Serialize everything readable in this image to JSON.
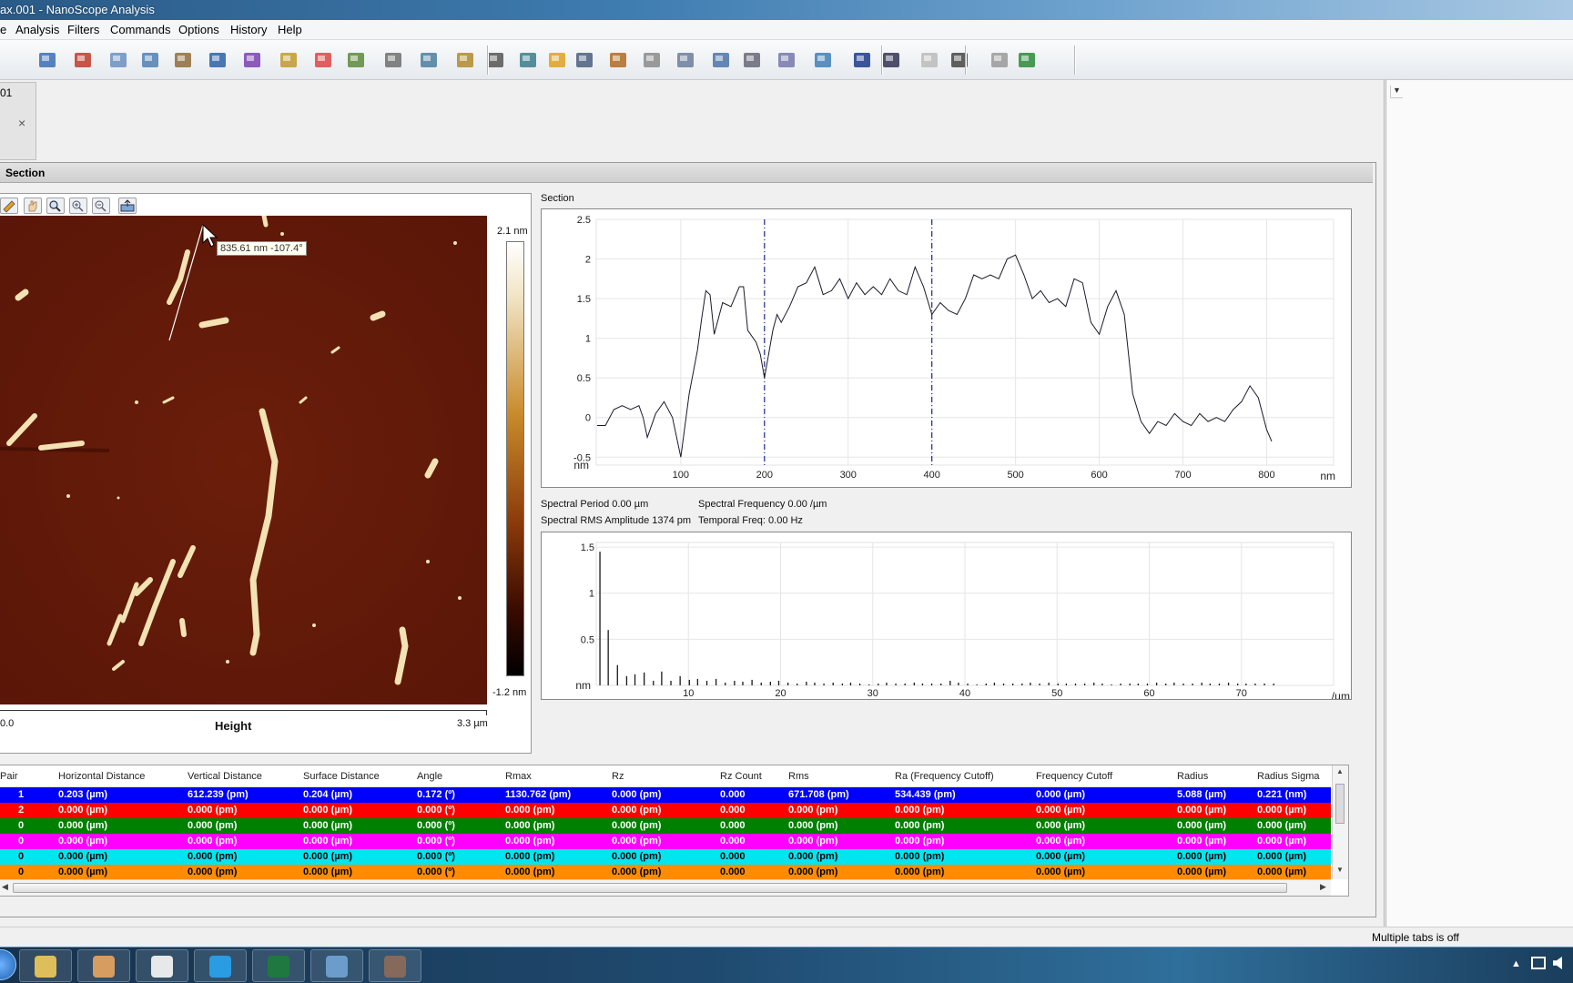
{
  "window": {
    "title": "ax.001 - NanoScope Analysis"
  },
  "menu": [
    "Analysis",
    "Filters",
    "Commands",
    "Options",
    "History",
    "Help"
  ],
  "doc_tab": {
    "label": "01",
    "close": "×"
  },
  "section": {
    "header": "Section"
  },
  "image": {
    "scale_max": "2.1 nm",
    "scale_min": "-1.2 nm",
    "x_start": "0.0",
    "x_end": "3.3 µm",
    "channel": "Height",
    "tooltip": "835.61 nm -107.4°"
  },
  "profile_chart": {
    "title": "Section",
    "y_unit": "nm",
    "x_unit": "nm",
    "y_ticks": [
      "2.5",
      "2",
      "1.5",
      "1",
      "0.5",
      "0",
      "-0.5"
    ],
    "x_ticks": [
      "100",
      "200",
      "300",
      "400",
      "500",
      "600",
      "700",
      "800"
    ]
  },
  "spectral": {
    "period": "Spectral Period 0.00 µm",
    "frequency": "Spectral Frequency 0.00 /µm",
    "rms": "Spectral RMS Amplitude 1374 pm",
    "temporal": "Temporal Freq: 0.00 Hz"
  },
  "spectrum_chart": {
    "y_unit": "nm",
    "x_unit": "/µm",
    "y_ticks": [
      "1.5",
      "1",
      "0.5"
    ],
    "x_ticks": [
      "10",
      "20",
      "30",
      "40",
      "50",
      "60",
      "70"
    ]
  },
  "chart_data": [
    {
      "type": "line",
      "title": "Section",
      "xlabel": "nm",
      "ylabel": "nm",
      "xlim": [
        -1,
        880
      ],
      "ylim": [
        -0.6,
        2.5
      ],
      "cursors_x": [
        200,
        400
      ],
      "x": [
        0,
        10,
        20,
        30,
        40,
        50,
        55,
        60,
        70,
        80,
        90,
        100,
        110,
        120,
        125,
        130,
        135,
        140,
        150,
        160,
        170,
        175,
        180,
        190,
        195,
        200,
        210,
        215,
        220,
        230,
        240,
        250,
        260,
        270,
        280,
        290,
        300,
        310,
        320,
        330,
        340,
        350,
        360,
        370,
        380,
        390,
        400,
        410,
        420,
        430,
        440,
        450,
        460,
        470,
        480,
        490,
        500,
        510,
        520,
        530,
        540,
        550,
        560,
        570,
        580,
        590,
        600,
        610,
        620,
        630,
        640,
        650,
        660,
        670,
        680,
        690,
        700,
        710,
        720,
        730,
        740,
        750,
        760,
        770,
        780,
        790,
        800,
        806
      ],
      "y": [
        -0.1,
        -0.1,
        0.1,
        0.15,
        0.1,
        0.15,
        0.0,
        -0.25,
        0.05,
        0.2,
        0.0,
        -0.5,
        0.3,
        0.85,
        1.25,
        1.6,
        1.55,
        1.05,
        1.45,
        1.4,
        1.65,
        1.65,
        1.1,
        0.95,
        0.8,
        0.5,
        1.1,
        1.3,
        1.2,
        1.4,
        1.65,
        1.7,
        1.9,
        1.55,
        1.6,
        1.75,
        1.5,
        1.7,
        1.55,
        1.65,
        1.55,
        1.75,
        1.6,
        1.55,
        1.9,
        1.65,
        1.3,
        1.45,
        1.35,
        1.3,
        1.5,
        1.8,
        1.75,
        1.8,
        1.75,
        2.0,
        2.05,
        1.8,
        1.5,
        1.6,
        1.45,
        1.5,
        1.4,
        1.75,
        1.7,
        1.2,
        1.05,
        1.4,
        1.6,
        1.3,
        0.3,
        -0.05,
        -0.2,
        -0.05,
        -0.1,
        0.05,
        -0.05,
        -0.1,
        0.05,
        -0.05,
        0.0,
        -0.05,
        0.1,
        0.2,
        0.4,
        0.25,
        -0.15,
        -0.3
      ]
    },
    {
      "type": "bar",
      "xlabel": "/µm",
      "ylabel": "nm",
      "xlim": [
        0,
        80
      ],
      "ylim": [
        0,
        1.55
      ],
      "x": [
        0.4,
        1.3,
        2.3,
        3.3,
        4.2,
        5.2,
        6.2,
        7.1,
        8.1,
        9.1,
        10.1,
        11.0,
        12.0,
        13.0,
        14.0,
        15.0,
        15.9,
        16.9,
        17.9,
        18.9,
        19.8,
        20.8,
        21.8,
        22.8,
        23.7,
        24.7,
        25.7,
        26.7,
        27.6,
        28.6,
        29.6,
        30.6,
        31.5,
        32.5,
        33.5,
        34.5,
        35.4,
        36.4,
        37.4,
        38.4,
        39.3,
        40.3,
        41.3,
        42.3,
        43.2,
        44.2,
        45.2,
        46.2,
        47.1,
        48.1,
        49.1,
        50.1,
        51.0,
        52.0,
        53.0,
        54.0,
        54.9,
        55.9,
        56.9,
        57.9,
        58.8,
        59.8,
        60.8,
        61.8,
        62.7,
        63.7,
        64.7,
        65.7,
        66.6,
        67.6,
        68.6,
        69.6,
        70.5,
        71.5,
        72.5,
        73.5
      ],
      "values": [
        1.45,
        0.6,
        0.22,
        0.1,
        0.12,
        0.14,
        0.05,
        0.15,
        0.05,
        0.1,
        0.06,
        0.07,
        0.05,
        0.07,
        0.03,
        0.05,
        0.04,
        0.06,
        0.03,
        0.04,
        0.05,
        0.03,
        0.02,
        0.04,
        0.03,
        0.02,
        0.03,
        0.02,
        0.03,
        0.02,
        0.01,
        0.02,
        0.03,
        0.02,
        0.02,
        0.03,
        0.02,
        0.02,
        0.02,
        0.05,
        0.03,
        0.02,
        0.01,
        0.02,
        0.03,
        0.02,
        0.02,
        0.02,
        0.03,
        0.02,
        0.03,
        0.02,
        0.02,
        0.02,
        0.02,
        0.03,
        0.02,
        0.01,
        0.02,
        0.02,
        0.02,
        0.02,
        0.03,
        0.02,
        0.03,
        0.02,
        0.02,
        0.03,
        0.02,
        0.02,
        0.03,
        0.02,
        0.02,
        0.02,
        0.02,
        0.02
      ]
    }
  ],
  "table": {
    "headers": [
      "Pair",
      "Horizontal Distance",
      "Vertical Distance",
      "Surface Distance",
      "Angle",
      "Rmax",
      "Rz",
      "Rz Count",
      "Rms",
      "Ra (Frequency Cutoff)",
      "Frequency Cutoff",
      "Radius",
      "Radius Sigma"
    ],
    "rows": [
      {
        "color": "#0000ff",
        "text": "#ffffff",
        "cells": [
          "1",
          "0.203 (µm)",
          "612.239 (pm)",
          "0.204 (µm)",
          "0.172 (º)",
          "1130.762 (pm)",
          "0.000 (pm)",
          "0.000",
          "671.708 (pm)",
          "534.439 (pm)",
          "0.000 (µm)",
          "5.088 (µm)",
          "0.221 (nm)"
        ]
      },
      {
        "color": "#ff0000",
        "text": "#ffffff",
        "cells": [
          "2",
          "0.000 (µm)",
          "0.000 (pm)",
          "0.000 (µm)",
          "0.000 (º)",
          "0.000 (pm)",
          "0.000 (pm)",
          "0.000",
          "0.000 (pm)",
          "0.000 (pm)",
          "0.000 (µm)",
          "0.000 (µm)",
          "0.000 (µm)"
        ]
      },
      {
        "color": "#008000",
        "text": "#ffffff",
        "cells": [
          "0",
          "0.000 (µm)",
          "0.000 (pm)",
          "0.000 (µm)",
          "0.000 (º)",
          "0.000 (pm)",
          "0.000 (pm)",
          "0.000",
          "0.000 (pm)",
          "0.000 (pm)",
          "0.000 (µm)",
          "0.000 (µm)",
          "0.000 (µm)"
        ]
      },
      {
        "color": "#ff00ff",
        "text": "#ffffff",
        "cells": [
          "0",
          "0.000 (µm)",
          "0.000 (pm)",
          "0.000 (µm)",
          "0.000 (º)",
          "0.000 (pm)",
          "0.000 (pm)",
          "0.000",
          "0.000 (pm)",
          "0.000 (pm)",
          "0.000 (µm)",
          "0.000 (µm)",
          "0.000 (µm)"
        ]
      },
      {
        "color": "#00e5ee",
        "text": "#000000",
        "cells": [
          "0",
          "0.000 (µm)",
          "0.000 (pm)",
          "0.000 (µm)",
          "0.000 (º)",
          "0.000 (pm)",
          "0.000 (pm)",
          "0.000",
          "0.000 (pm)",
          "0.000 (pm)",
          "0.000 (µm)",
          "0.000 (µm)",
          "0.000 (µm)"
        ]
      },
      {
        "color": "#ff8c00",
        "text": "#000000",
        "cells": [
          "0",
          "0.000 (µm)",
          "0.000 (pm)",
          "0.000 (µm)",
          "0.000 (º)",
          "0.000 (pm)",
          "0.000 (pm)",
          "0.000",
          "0.000 (pm)",
          "0.000 (pm)",
          "0.000 (µm)",
          "0.000 (µm)",
          "0.000 (µm)"
        ]
      }
    ]
  },
  "status": {
    "text": "Multiple tabs is off"
  },
  "toolbar_icons": [
    "help-icon",
    "view-3d-icon",
    "move-icon",
    "layers-icon",
    "stack-icon",
    "export-icon",
    "bar-chart-icon",
    "flatten-icon",
    "color-map-icon",
    "histogram-icon",
    "probe-icon",
    "step-icon",
    "ruler-icon",
    "scan-icon",
    "tip-icon",
    "crop-icon",
    "brush-icon",
    "erase-icon",
    "filter-icon",
    "calculator-icon",
    "filter-plot-icon",
    "filter-grid-icon",
    "transfer-icon",
    "rotate-icon",
    "fft-icon",
    "batch-icon",
    "page-icon",
    "undo-icon",
    "redo-icon",
    "run-icon"
  ],
  "taskbar_items": [
    "file-explorer-icon",
    "media-player-icon",
    "chrome-icon",
    "skype-icon",
    "excel-icon",
    "photos-icon",
    "nanoscope-icon"
  ]
}
